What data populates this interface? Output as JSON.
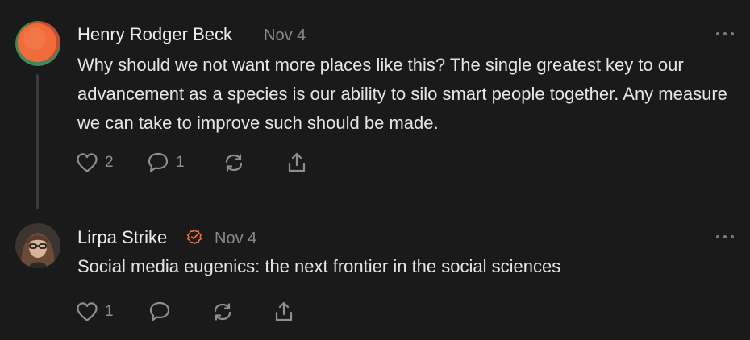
{
  "comments": [
    {
      "author": "Henry Rodger Beck",
      "date": "Nov 4",
      "avatar": "orange-circle-logo-avatar",
      "verified": false,
      "text": "Why should we not want more places like this? The single greatest key to our advancement as a species is our ability to silo smart people together. Any measure we can take to improve such should be made.",
      "likes": "2",
      "replies": "1",
      "colors": {
        "avatar_primary": "#f26b3a",
        "avatar_secondary": "#3f8a5b"
      }
    },
    {
      "author": "Lirpa Strike",
      "date": "Nov 4",
      "avatar": "portrait-photo-avatar",
      "verified": true,
      "text": "Social media eugenics: the next frontier in the social sciences",
      "likes": "1",
      "replies": "",
      "colors": {
        "verified_badge": "#f0703a"
      }
    }
  ],
  "icons": {
    "like": "heart-icon",
    "reply": "comment-bubble-icon",
    "restack": "restack-icon",
    "share": "share-icon",
    "more": "more-options-icon"
  }
}
